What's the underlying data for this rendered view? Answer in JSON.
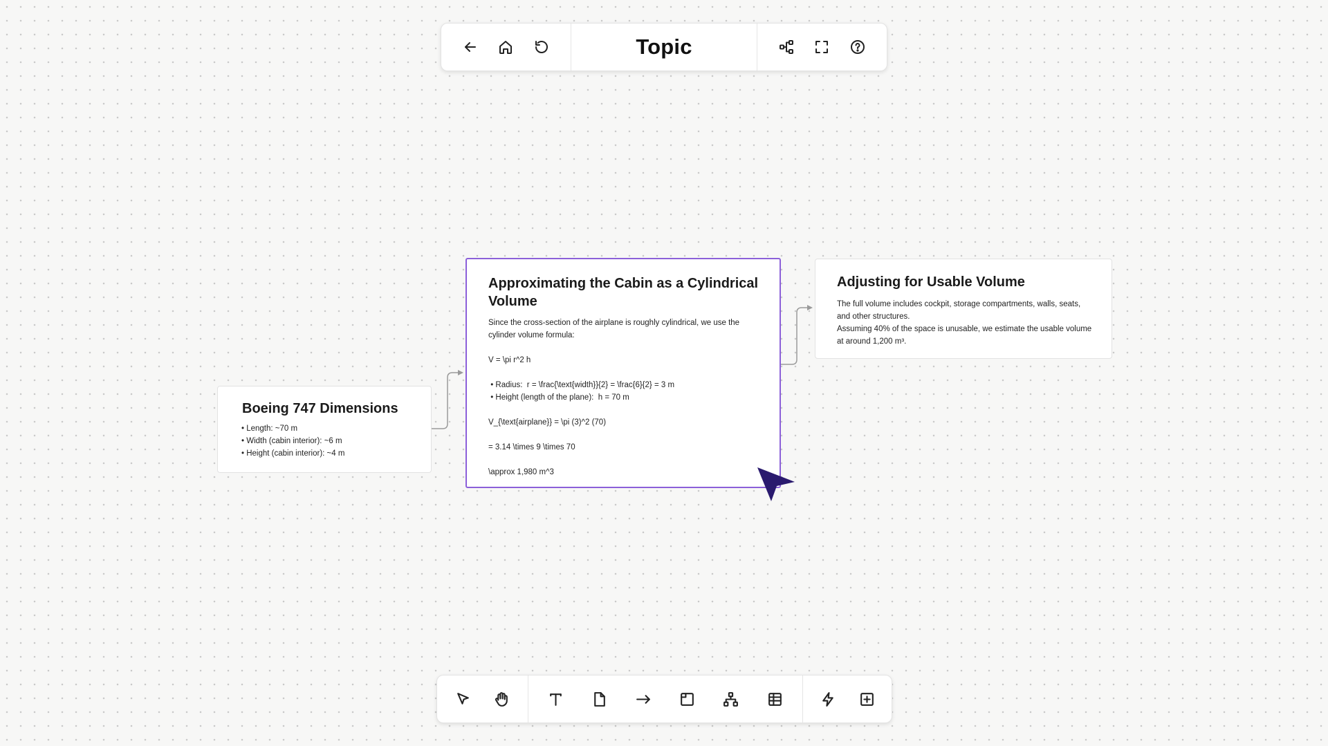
{
  "header": {
    "title": "Topic",
    "back_icon": "arrow-left-icon",
    "home_icon": "home-icon",
    "refresh_icon": "refresh-icon",
    "mindmap_icon": "mindmap-icon",
    "fullscreen_icon": "fullscreen-icon",
    "help_icon": "help-icon"
  },
  "cards": {
    "boeing": {
      "title": "Boeing 747 Dimensions",
      "body": "• Length: ~70 m\n• Width (cabin interior): ~6 m\n• Height (cabin interior): ~4 m"
    },
    "cabin": {
      "title": "Approximating the Cabin as a Cylindrical Volume",
      "body": "Since the cross-section of the airplane is roughly cylindrical, we use the cylinder volume formula:\n\nV = \\pi r^2 h\n\n • Radius:  r = \\frac{\\text{width}}{2} = \\frac{6}{2} = 3 m\n • Height (length of the plane):  h = 70 m\n\nV_{\\text{airplane}} = \\pi (3)^2 (70)\n\n= 3.14 \\times 9 \\times 70\n\n\\approx 1,980 m^3"
    },
    "usable": {
      "title": "Adjusting for Usable Volume",
      "body": "The full volume includes cockpit, storage compartments, walls, seats, and other structures.\nAssuming 40% of the space is unusable, we estimate the usable volume at around 1,200 m³."
    }
  },
  "bottom_toolbar": {
    "tools": [
      "select-tool",
      "hand-tool",
      "text-tool",
      "note-tool",
      "arrow-tool",
      "frame-tool",
      "hierarchy-tool",
      "table-tool",
      "ai-tool",
      "add-tool"
    ]
  },
  "colors": {
    "selected_border": "#8b5fd9",
    "cursor": "#2a1a6e",
    "connector": "#9a9a9a"
  }
}
